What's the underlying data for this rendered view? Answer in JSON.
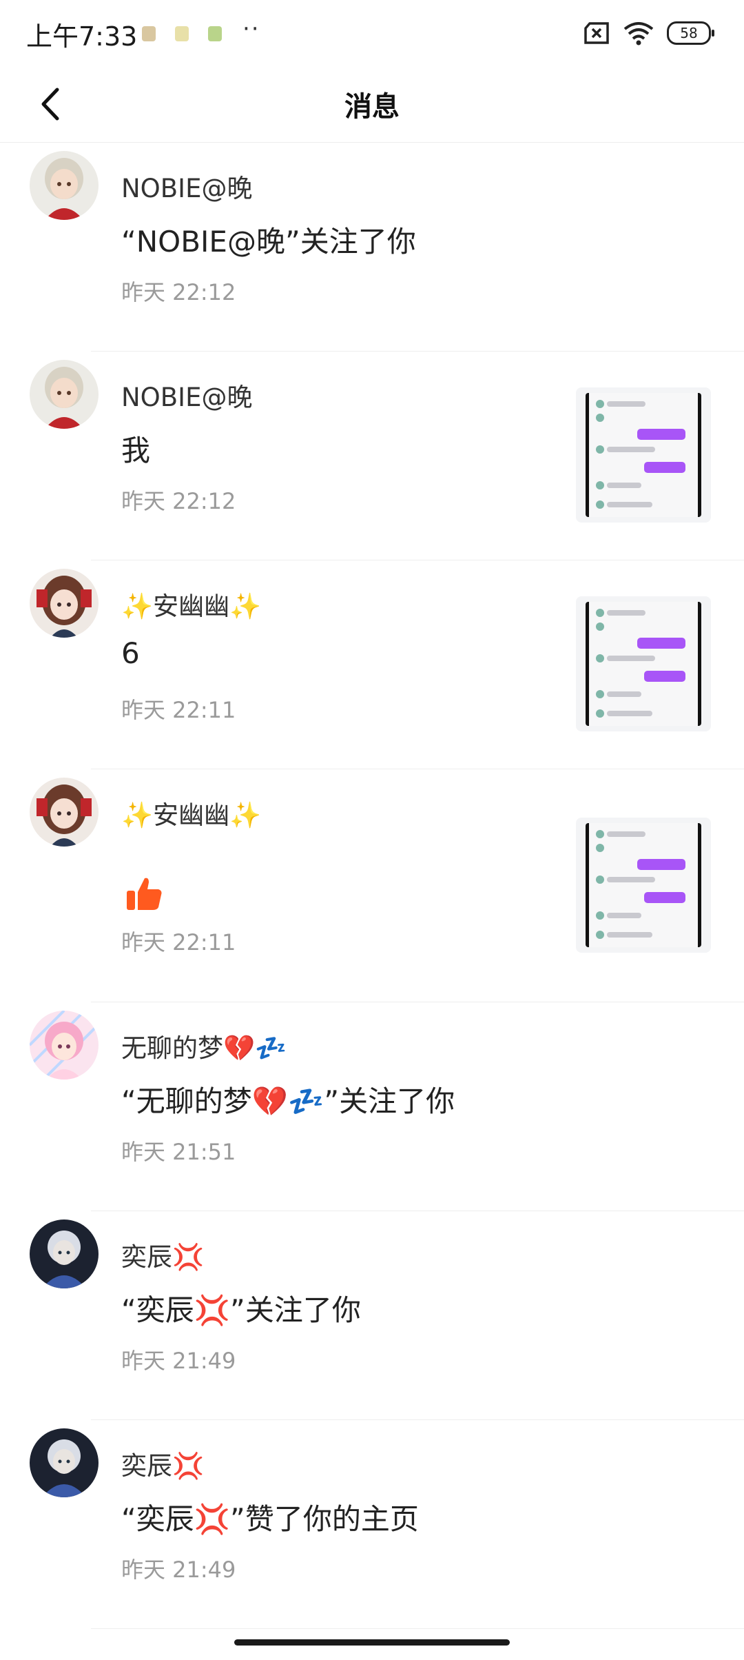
{
  "status_bar": {
    "time": "上午7:33",
    "dots": "··",
    "battery": "58"
  },
  "header": {
    "title": "消息"
  },
  "messages": [
    {
      "name": "NOBIE@晚",
      "content": "“NOBIE@晚”关注了你",
      "time": "昨天 22:12",
      "has_thumb": false
    },
    {
      "name": "NOBIE@晚",
      "content": "我",
      "time": "昨天 22:12",
      "has_thumb": true
    },
    {
      "name": "✨安幽幽✨",
      "content": "6",
      "time": "昨天 22:11",
      "has_thumb": true
    },
    {
      "name": "✨安幽幽✨",
      "content": "",
      "time": "昨天 22:11",
      "has_thumb": true
    },
    {
      "name": "无聊的梦💔💤",
      "content": "“无聊的梦💔💤”关注了你",
      "time": "昨天 21:51",
      "has_thumb": false
    },
    {
      "name": "奕辰💢",
      "content": "“奕辰💢”关注了你",
      "time": "昨天 21:49",
      "has_thumb": false
    },
    {
      "name": "奕辰💢",
      "content": "“奕辰💢”赞了你的主页",
      "time": "昨天 21:49",
      "has_thumb": false
    }
  ],
  "colors": {
    "divider": "#eeeeee",
    "time_text": "#9a9a9a",
    "like_orange": "#ff5a1f",
    "thumb_bubble": "#a855f7"
  }
}
